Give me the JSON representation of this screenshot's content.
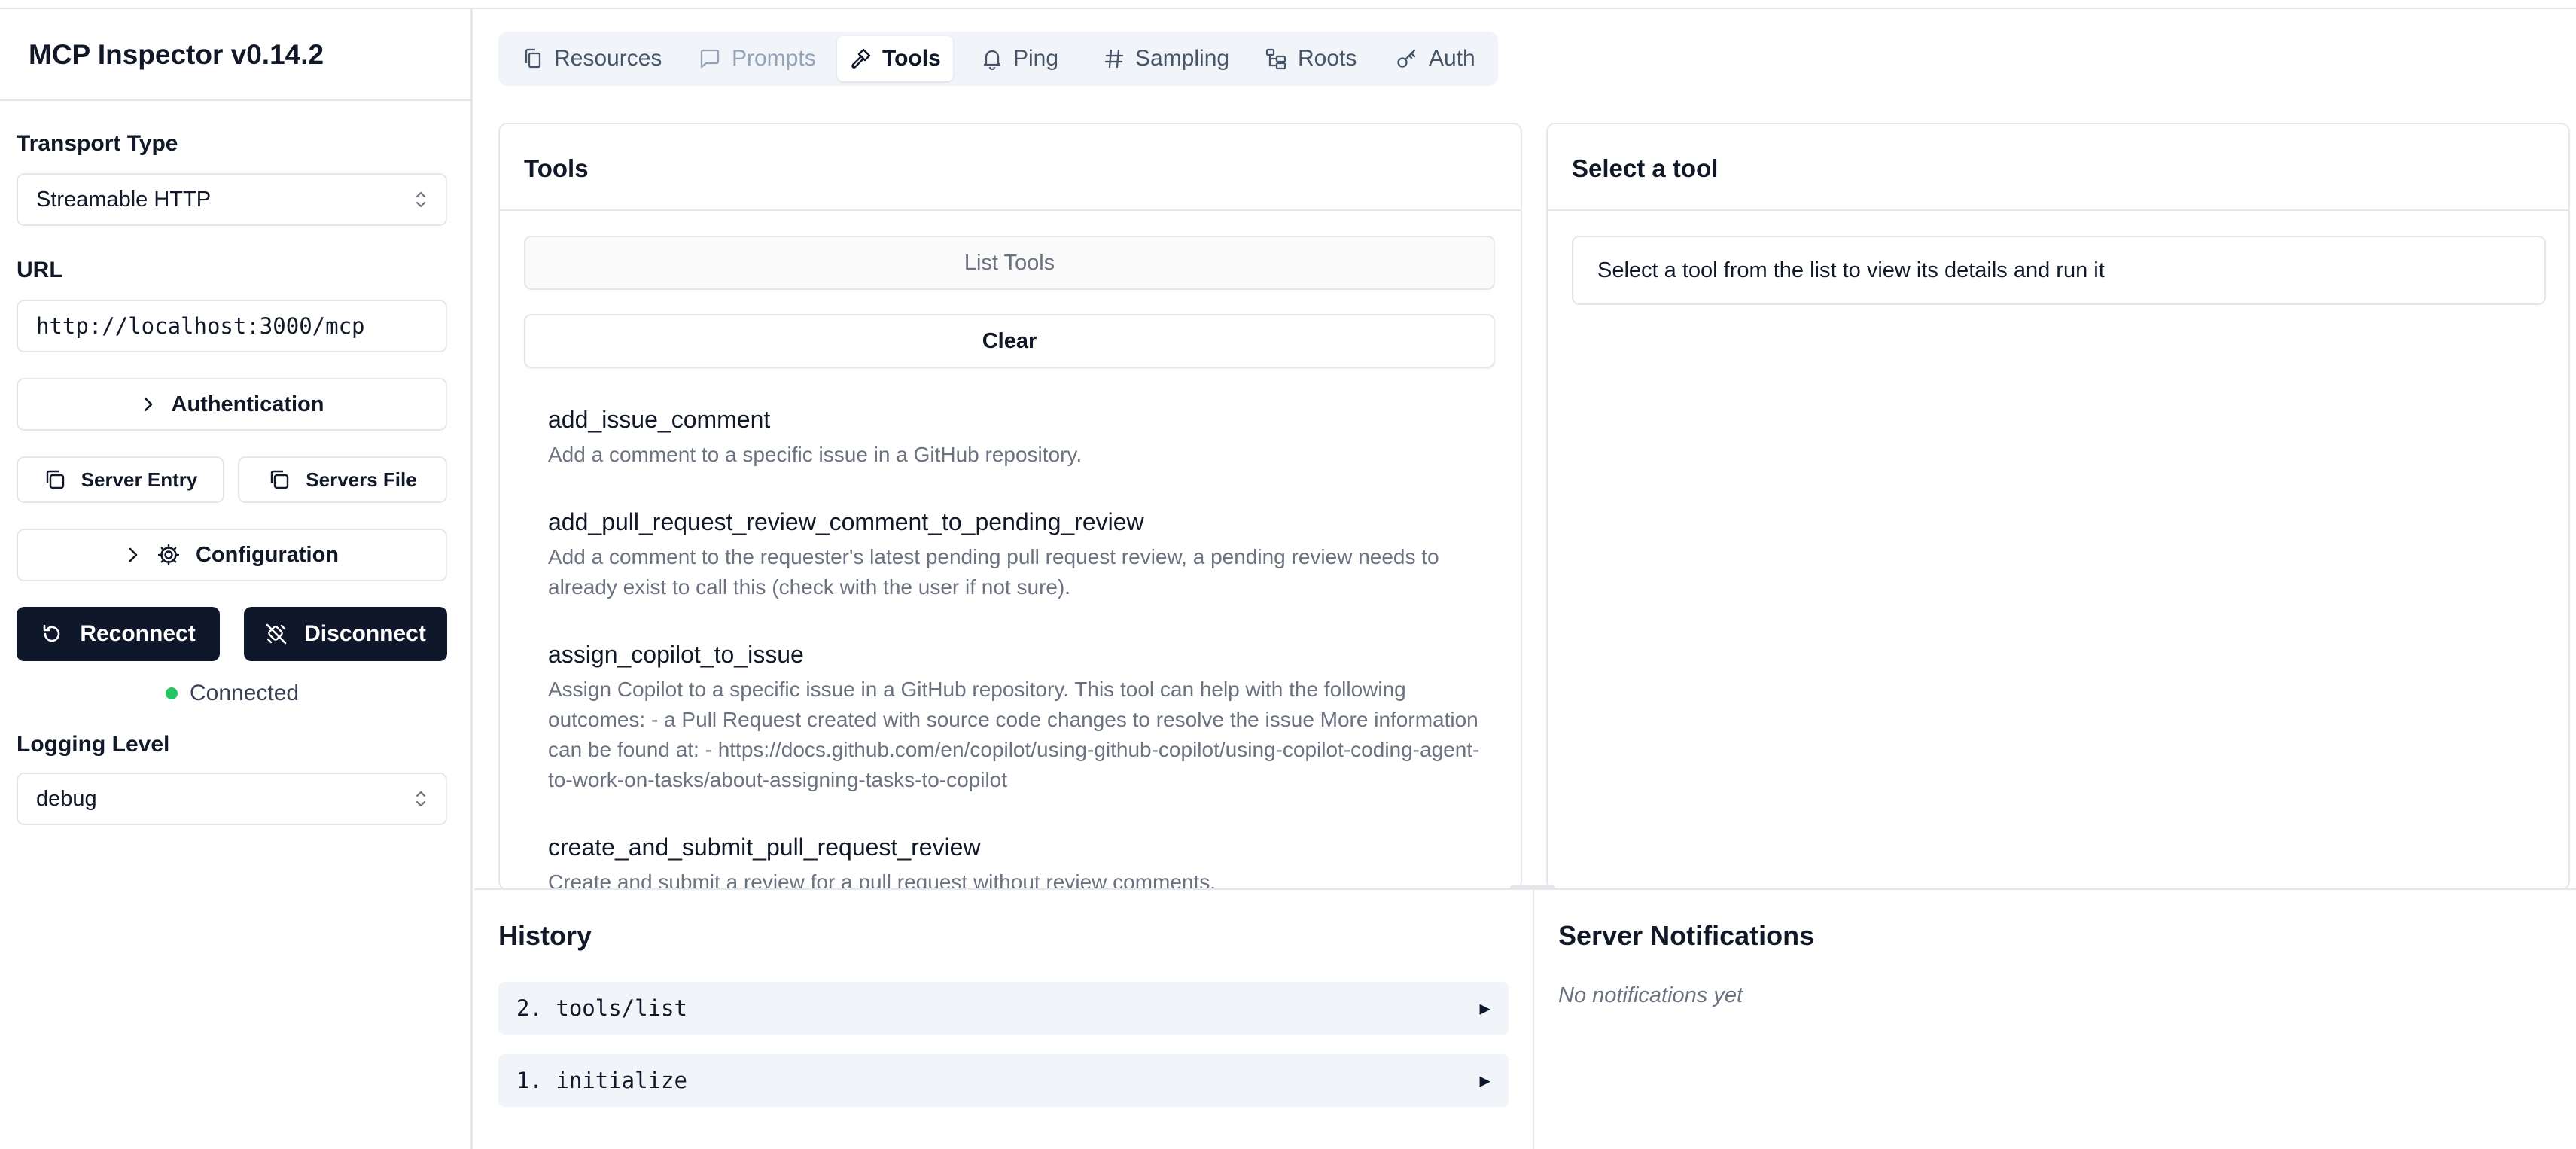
{
  "app": {
    "title": "MCP Inspector v0.14.2"
  },
  "sidebar": {
    "transport_label": "Transport Type",
    "transport_value": "Streamable HTTP",
    "url_label": "URL",
    "url_value": "http://localhost:3000/mcp",
    "authentication_label": "Authentication",
    "server_entry_label": "Server Entry",
    "servers_file_label": "Servers File",
    "configuration_label": "Configuration",
    "reconnect_label": "Reconnect",
    "disconnect_label": "Disconnect",
    "status_text": "Connected",
    "status_color": "#22c55e",
    "logging_label": "Logging Level",
    "logging_value": "debug"
  },
  "tabs": [
    {
      "label": "Resources",
      "icon": "files-icon",
      "state": "normal"
    },
    {
      "label": "Prompts",
      "icon": "message-square-icon",
      "state": "disabled"
    },
    {
      "label": "Tools",
      "icon": "hammer-icon",
      "state": "active"
    },
    {
      "label": "Ping",
      "icon": "bell-icon",
      "state": "normal"
    },
    {
      "label": "Sampling",
      "icon": "hash-icon",
      "state": "normal"
    },
    {
      "label": "Roots",
      "icon": "folder-tree-icon",
      "state": "normal"
    },
    {
      "label": "Auth",
      "icon": "key-icon",
      "state": "normal"
    }
  ],
  "tools_panel": {
    "title": "Tools",
    "list_button": "List Tools",
    "clear_button": "Clear",
    "items": [
      {
        "name": "add_issue_comment",
        "description": "Add a comment to a specific issue in a GitHub repository."
      },
      {
        "name": "add_pull_request_review_comment_to_pending_review",
        "description": "Add a comment to the requester's latest pending pull request review, a pending review needs to already exist to call this (check with the user if not sure)."
      },
      {
        "name": "assign_copilot_to_issue",
        "description": "Assign Copilot to a specific issue in a GitHub repository. This tool can help with the following outcomes: - a Pull Request created with source code changes to resolve the issue More information can be found at: - https://docs.github.com/en/copilot/using-github-copilot/using-copilot-coding-agent-to-work-on-tasks/about-assigning-tasks-to-copilot"
      },
      {
        "name": "create_and_submit_pull_request_review",
        "description": "Create and submit a review for a pull request without review comments."
      }
    ]
  },
  "detail_panel": {
    "title": "Select a tool",
    "hint": "Select a tool from the list to view its details and run it"
  },
  "history": {
    "title": "History",
    "items": [
      "2. tools/list",
      "1. initialize"
    ]
  },
  "notifications": {
    "title": "Server Notifications",
    "empty": "No notifications yet"
  }
}
